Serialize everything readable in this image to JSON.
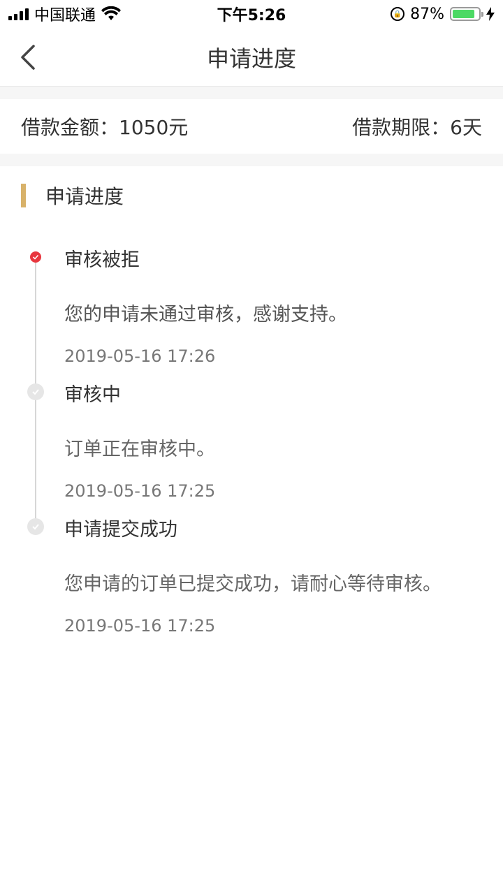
{
  "status_bar": {
    "carrier": "中国联通",
    "time": "下午5:26",
    "battery_percent": "87%",
    "battery_level": 0.87,
    "icons": [
      "signal-icon",
      "wifi-icon",
      "rotation-lock-icon",
      "battery-icon",
      "charging-icon"
    ]
  },
  "nav": {
    "title": "申请进度",
    "back_icon": "chevron-left-icon"
  },
  "loan": {
    "amount_label": "借款金额：1050元",
    "term_label": "借款期限：6天"
  },
  "section": {
    "title": "申请进度",
    "accent_color": "#d8b26a"
  },
  "timeline": [
    {
      "status": "审核被拒",
      "message": "您的申请未通过审核，感谢支持。",
      "time": "2019-05-16 17:26",
      "state": "active",
      "icon": "check-circle-icon",
      "color": "#e8373f"
    },
    {
      "status": "审核中",
      "message": "订单正在审核中。",
      "time": "2019-05-16 17:25",
      "state": "inactive",
      "icon": "check-circle-icon",
      "color": "#e6e6e6"
    },
    {
      "status": "申请提交成功",
      "message": "您申请的订单已提交成功，请耐心等待审核。",
      "time": "2019-05-16 17:25",
      "state": "inactive",
      "icon": "check-circle-icon",
      "color": "#e6e6e6"
    }
  ]
}
